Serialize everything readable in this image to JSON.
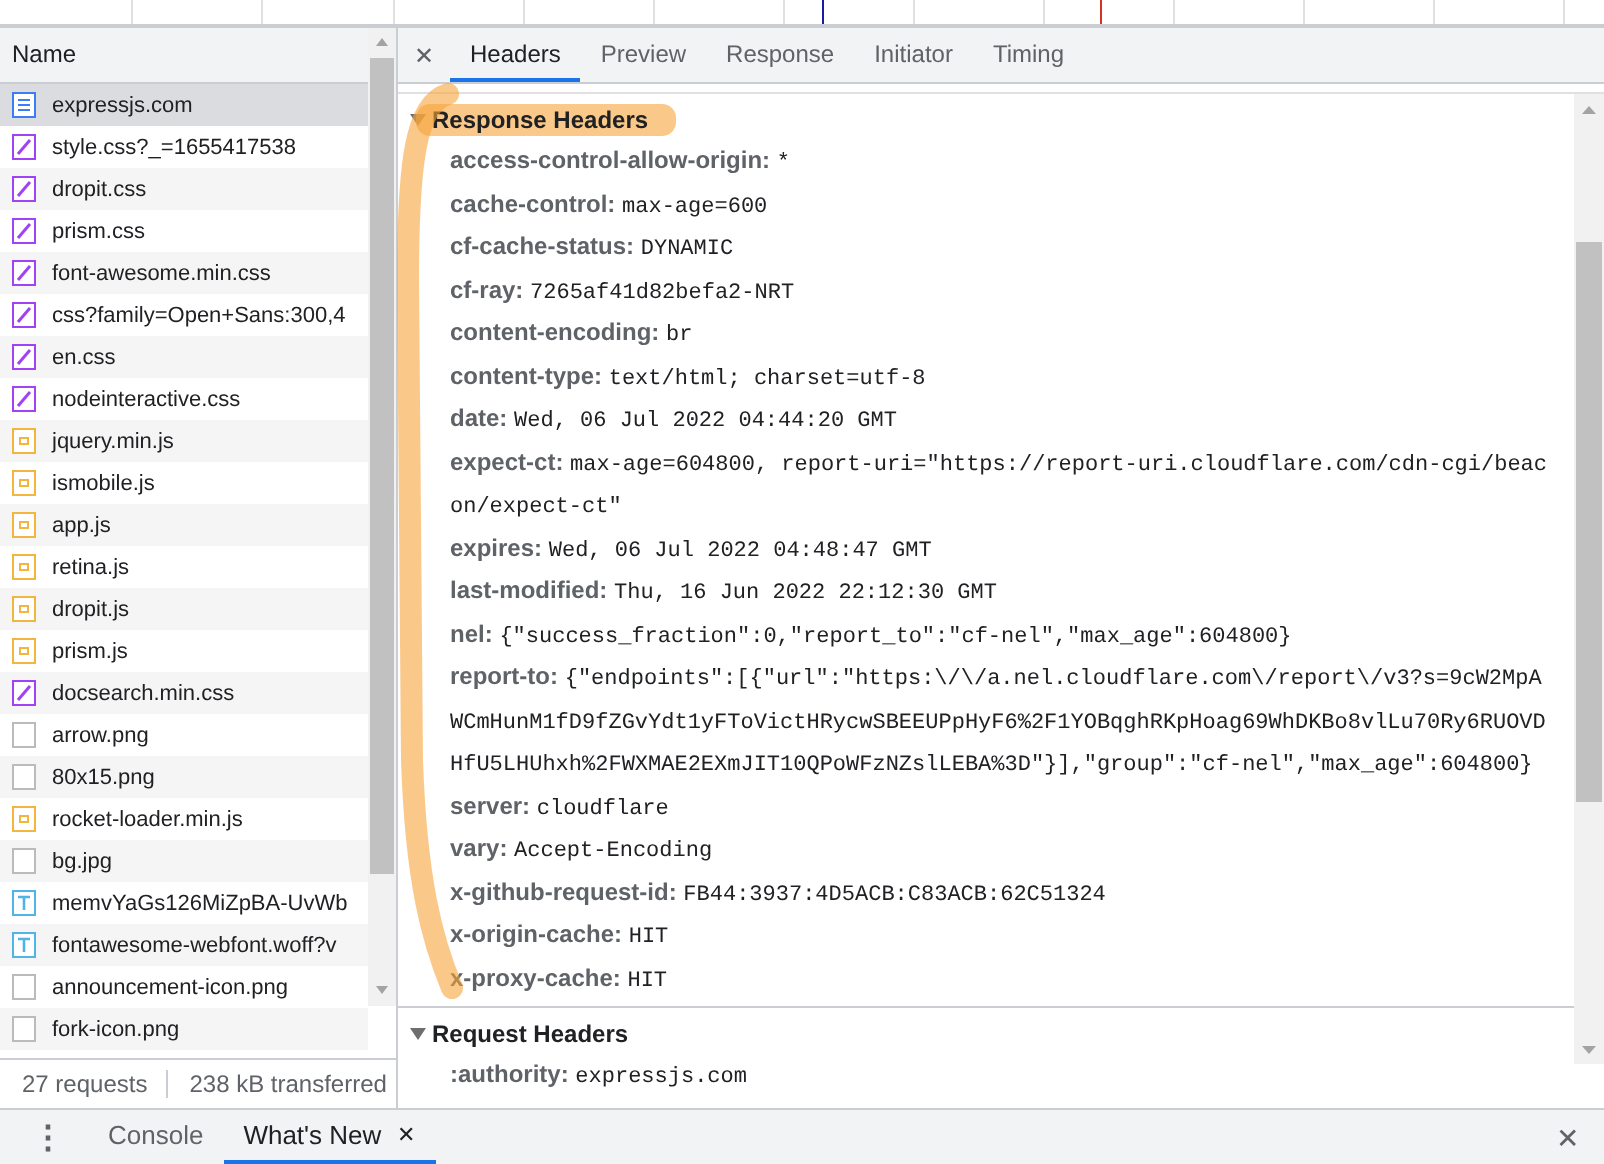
{
  "requests": {
    "column_header": "Name",
    "rows": [
      {
        "name": "expressjs.com",
        "kind": "document",
        "selected": true
      },
      {
        "name": "style.css?_=1655417538",
        "kind": "stylesheet",
        "selected": false
      },
      {
        "name": "dropit.css",
        "kind": "stylesheet",
        "selected": false
      },
      {
        "name": "prism.css",
        "kind": "stylesheet",
        "selected": false
      },
      {
        "name": "font-awesome.min.css",
        "kind": "stylesheet",
        "selected": false
      },
      {
        "name": "css?family=Open+Sans:300,4",
        "kind": "stylesheet",
        "selected": false
      },
      {
        "name": "en.css",
        "kind": "stylesheet",
        "selected": false
      },
      {
        "name": "nodeinteractive.css",
        "kind": "stylesheet",
        "selected": false
      },
      {
        "name": "jquery.min.js",
        "kind": "script",
        "selected": false
      },
      {
        "name": "ismobile.js",
        "kind": "script",
        "selected": false
      },
      {
        "name": "app.js",
        "kind": "script",
        "selected": false
      },
      {
        "name": "retina.js",
        "kind": "script",
        "selected": false
      },
      {
        "name": "dropit.js",
        "kind": "script",
        "selected": false
      },
      {
        "name": "prism.js",
        "kind": "script",
        "selected": false
      },
      {
        "name": "docsearch.min.css",
        "kind": "stylesheet",
        "selected": false
      },
      {
        "name": "arrow.png",
        "kind": "image",
        "selected": false
      },
      {
        "name": "80x15.png",
        "kind": "image",
        "selected": false
      },
      {
        "name": "rocket-loader.min.js",
        "kind": "script",
        "selected": false
      },
      {
        "name": "bg.jpg",
        "kind": "image",
        "selected": false
      },
      {
        "name": "memvYaGs126MiZpBA-UvWb",
        "kind": "font",
        "selected": false
      },
      {
        "name": "fontawesome-webfont.woff?v",
        "kind": "font",
        "selected": false
      },
      {
        "name": "announcement-icon.png",
        "kind": "image",
        "selected": false
      },
      {
        "name": "fork-icon.png",
        "kind": "image",
        "selected": false
      }
    ],
    "status": [
      "27 requests",
      "238 kB transferred"
    ]
  },
  "detail_close": "✕",
  "detail_tabs": [
    {
      "label": "Headers",
      "selected": true
    },
    {
      "label": "Preview",
      "selected": false
    },
    {
      "label": "Response",
      "selected": false
    },
    {
      "label": "Initiator",
      "selected": false
    },
    {
      "label": "Timing",
      "selected": false
    }
  ],
  "sections": [
    {
      "title": "Response Headers",
      "expanded": true,
      "highlighted": true,
      "headers": [
        {
          "key": "access-control-allow-origin:",
          "value": "*"
        },
        {
          "key": "cache-control:",
          "value": "max-age=600"
        },
        {
          "key": "cf-cache-status:",
          "value": "DYNAMIC"
        },
        {
          "key": "cf-ray:",
          "value": "7265af41d82befa2-NRT"
        },
        {
          "key": "content-encoding:",
          "value": "br"
        },
        {
          "key": "content-type:",
          "value": "text/html; charset=utf-8"
        },
        {
          "key": "date:",
          "value": "Wed, 06 Jul 2022 04:44:20 GMT"
        },
        {
          "key": "expect-ct:",
          "value": "max-age=604800, report-uri=\"https://report-uri.cloudflare.com/cdn-cgi/beacon/expect-ct\""
        },
        {
          "key": "expires:",
          "value": "Wed, 06 Jul 2022 04:48:47 GMT"
        },
        {
          "key": "last-modified:",
          "value": "Thu, 16 Jun 2022 22:12:30 GMT"
        },
        {
          "key": "nel:",
          "value": "{\"success_fraction\":0,\"report_to\":\"cf-nel\",\"max_age\":604800}"
        },
        {
          "key": "report-to:",
          "value": "{\"endpoints\":[{\"url\":\"https:\\/\\/a.nel.cloudflare.com\\/report\\/v3?s=9cW2MpAWCmHunM1fD9fZGvYdt1yFToVictHRycwSBEEUPpHyF6%2F1YOBqghRKpHoag69WhDKBo8vlLu70Ry6RUOVDHfU5LHUhxh%2FWXMAE2EXmJIT10QPoWFzNZslLEBA%3D\"}],\"group\":\"cf-nel\",\"max_age\":604800}"
        },
        {
          "key": "server:",
          "value": "cloudflare"
        },
        {
          "key": "vary:",
          "value": "Accept-Encoding"
        },
        {
          "key": "x-github-request-id:",
          "value": "FB44:3937:4D5ACB:C83ACB:62C51324"
        },
        {
          "key": "x-origin-cache:",
          "value": "HIT"
        },
        {
          "key": "x-proxy-cache:",
          "value": "HIT"
        }
      ]
    },
    {
      "title": "Request Headers",
      "expanded": true,
      "highlighted": false,
      "headers": [
        {
          "key": ":authority:",
          "value": "expressjs.com"
        }
      ]
    }
  ],
  "drawer": {
    "menu_glyph": "⋮",
    "tabs": [
      {
        "label": "Console",
        "selected": false
      },
      {
        "label": "What's New",
        "selected": true,
        "close": "✕"
      }
    ],
    "close": "✕"
  }
}
